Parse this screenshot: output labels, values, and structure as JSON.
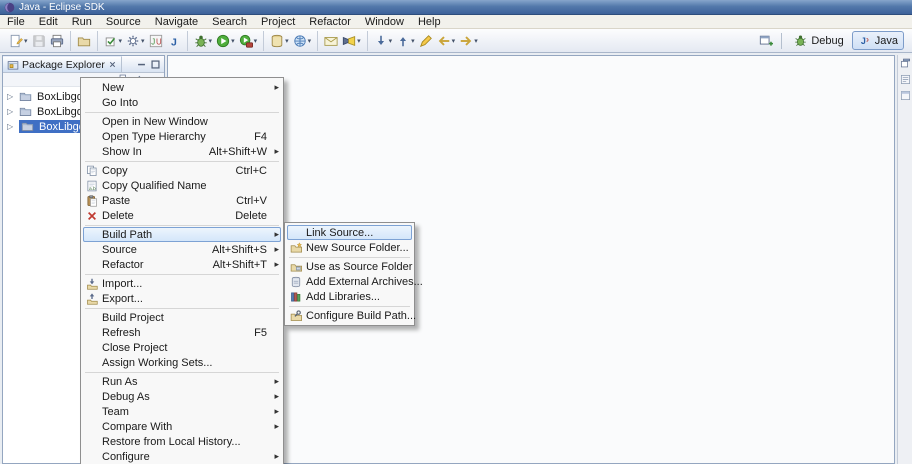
{
  "window": {
    "title": "Java - Eclipse SDK"
  },
  "menubar": {
    "items": [
      "File",
      "Edit",
      "Run",
      "Source",
      "Navigate",
      "Search",
      "Project",
      "Refactor",
      "Window",
      "Help"
    ]
  },
  "toolbar": {
    "groups": [
      {
        "buttons": [
          {
            "name": "new-wizard",
            "dropdown": true
          },
          {
            "name": "save",
            "disabled": true
          },
          {
            "name": "print"
          }
        ]
      },
      {
        "buttons": [
          {
            "name": "open-folder"
          }
        ]
      },
      {
        "buttons": [
          {
            "name": "debug-checkbox",
            "dropdown": true
          },
          {
            "name": "launch-config",
            "dropdown": true
          },
          {
            "name": "junit"
          },
          {
            "name": "java-application"
          }
        ]
      },
      {
        "buttons": [
          {
            "name": "debug",
            "dropdown": true
          },
          {
            "name": "run",
            "dropdown": true
          },
          {
            "name": "external-tools",
            "dropdown": true
          }
        ]
      },
      {
        "buttons": [
          {
            "name": "new-jar",
            "dropdown": true
          },
          {
            "name": "new-web",
            "dropdown": true
          }
        ]
      },
      {
        "buttons": [
          {
            "name": "new-task"
          },
          {
            "name": "search",
            "dropdown": true
          }
        ]
      },
      {
        "buttons": [
          {
            "name": "next-annotation",
            "dropdown": true
          },
          {
            "name": "previous-annotation",
            "dropdown": true
          },
          {
            "name": "last-edit-location"
          },
          {
            "name": "back",
            "dropdown": true
          },
          {
            "name": "forward",
            "dropdown": true
          }
        ]
      }
    ]
  },
  "perspective_bar": {
    "buttons": [
      {
        "label": "Debug",
        "icon": "debug",
        "active": false
      },
      {
        "label": "Java",
        "icon": "persp-java",
        "active": true
      }
    ]
  },
  "package_explorer": {
    "tab_title": "Package Explorer",
    "tree": [
      {
        "label": "BoxLibgdxExa",
        "selected": false
      },
      {
        "label": "BoxLibgdxExa",
        "selected": false
      },
      {
        "label": "BoxLibgdxExa",
        "selected": true
      }
    ]
  },
  "context_menu": {
    "items": [
      {
        "label": "New",
        "submenu": true
      },
      {
        "label": "Go Into"
      },
      {
        "type": "sep"
      },
      {
        "label": "Open in New Window"
      },
      {
        "label": "Open Type Hierarchy",
        "shortcut": "F4"
      },
      {
        "label": "Show In",
        "shortcut": "Alt+Shift+W",
        "submenu": true
      },
      {
        "type": "sep"
      },
      {
        "label": "Copy",
        "shortcut": "Ctrl+C",
        "icon": "copy"
      },
      {
        "label": "Copy Qualified Name",
        "icon": "copy-qualified"
      },
      {
        "label": "Paste",
        "shortcut": "Ctrl+V",
        "icon": "paste"
      },
      {
        "label": "Delete",
        "shortcut": "Delete",
        "icon": "delete"
      },
      {
        "type": "sep"
      },
      {
        "label": "Build Path",
        "submenu": true,
        "highlighted": true
      },
      {
        "label": "Source",
        "shortcut": "Alt+Shift+S",
        "submenu": true
      },
      {
        "label": "Refactor",
        "shortcut": "Alt+Shift+T",
        "submenu": true
      },
      {
        "type": "sep"
      },
      {
        "label": "Import...",
        "icon": "import"
      },
      {
        "label": "Export...",
        "icon": "export"
      },
      {
        "type": "sep"
      },
      {
        "label": "Build Project"
      },
      {
        "label": "Refresh",
        "shortcut": "F5"
      },
      {
        "label": "Close Project"
      },
      {
        "label": "Assign Working Sets..."
      },
      {
        "type": "sep"
      },
      {
        "label": "Run As",
        "submenu": true
      },
      {
        "label": "Debug As",
        "submenu": true
      },
      {
        "label": "Team",
        "submenu": true
      },
      {
        "label": "Compare With",
        "submenu": true
      },
      {
        "label": "Restore from Local History..."
      },
      {
        "label": "Configure",
        "submenu": true
      }
    ]
  },
  "build_path_submenu": {
    "items": [
      {
        "label": "Link Source...",
        "highlighted": true
      },
      {
        "label": "New Source Folder...",
        "icon": "new-source-folder"
      },
      {
        "type": "sep"
      },
      {
        "label": "Use as Source Folder",
        "icon": "source-folder"
      },
      {
        "label": "Add External Archives...",
        "icon": "external-archive"
      },
      {
        "label": "Add Libraries...",
        "icon": "library"
      },
      {
        "type": "sep"
      },
      {
        "label": "Configure Build Path...",
        "icon": "configure-build-path"
      }
    ]
  }
}
